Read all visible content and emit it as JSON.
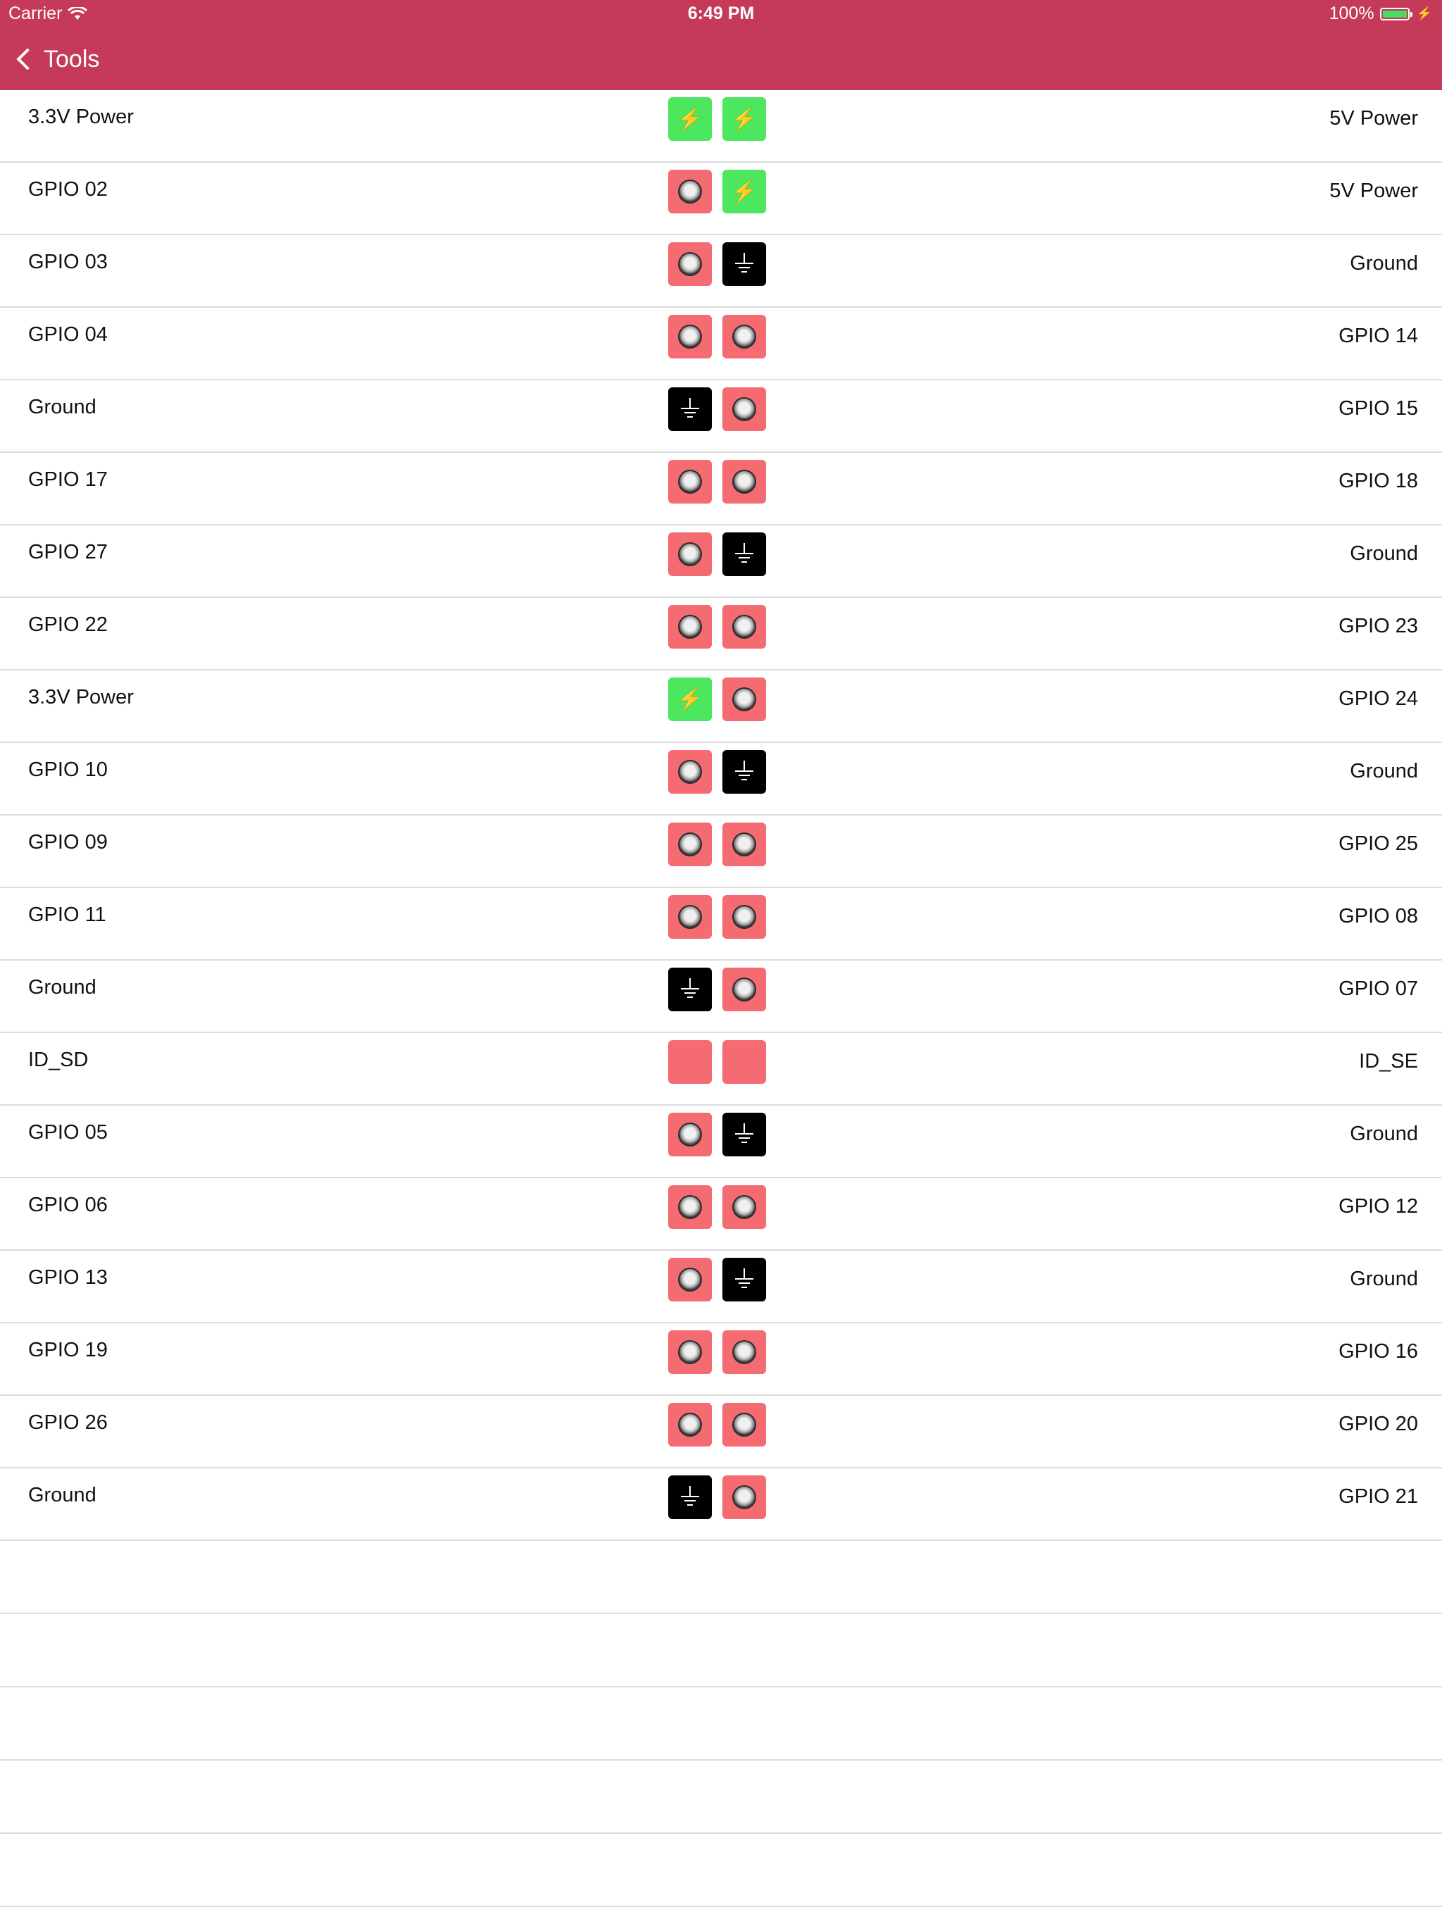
{
  "status_bar": {
    "carrier": "Carrier",
    "time": "6:49 PM",
    "battery": "100%"
  },
  "nav": {
    "back_label": "Tools"
  },
  "colors": {
    "brand": "#c53a59",
    "power": "#4ce65f",
    "gpio": "#f46b72",
    "ground": "#000000"
  },
  "pins": [
    {
      "left_label": "3.3V Power",
      "left_type": "power",
      "right_type": "power",
      "right_label": "5V Power"
    },
    {
      "left_label": "GPIO 02",
      "left_type": "gpio",
      "right_type": "power",
      "right_label": "5V Power"
    },
    {
      "left_label": "GPIO 03",
      "left_type": "gpio",
      "right_type": "ground",
      "right_label": "Ground"
    },
    {
      "left_label": "GPIO 04",
      "left_type": "gpio",
      "right_type": "gpio",
      "right_label": "GPIO 14"
    },
    {
      "left_label": "Ground",
      "left_type": "ground",
      "right_type": "gpio",
      "right_label": "GPIO 15"
    },
    {
      "left_label": "GPIO 17",
      "left_type": "gpio",
      "right_type": "gpio",
      "right_label": "GPIO 18"
    },
    {
      "left_label": "GPIO 27",
      "left_type": "gpio",
      "right_type": "ground",
      "right_label": "Ground"
    },
    {
      "left_label": "GPIO 22",
      "left_type": "gpio",
      "right_type": "gpio",
      "right_label": "GPIO 23"
    },
    {
      "left_label": "3.3V Power",
      "left_type": "power",
      "right_type": "gpio",
      "right_label": "GPIO 24"
    },
    {
      "left_label": "GPIO 10",
      "left_type": "gpio",
      "right_type": "ground",
      "right_label": "Ground"
    },
    {
      "left_label": "GPIO 09",
      "left_type": "gpio",
      "right_type": "gpio",
      "right_label": "GPIO 25"
    },
    {
      "left_label": "GPIO 11",
      "left_type": "gpio",
      "right_type": "gpio",
      "right_label": "GPIO 08"
    },
    {
      "left_label": "Ground",
      "left_type": "ground",
      "right_type": "gpio",
      "right_label": "GPIO 07"
    },
    {
      "left_label": "ID_SD",
      "left_type": "blank",
      "right_type": "blank",
      "right_label": "ID_SE"
    },
    {
      "left_label": "GPIO 05",
      "left_type": "gpio",
      "right_type": "ground",
      "right_label": "Ground"
    },
    {
      "left_label": "GPIO 06",
      "left_type": "gpio",
      "right_type": "gpio",
      "right_label": "GPIO 12"
    },
    {
      "left_label": "GPIO 13",
      "left_type": "gpio",
      "right_type": "ground",
      "right_label": "Ground"
    },
    {
      "left_label": "GPIO 19",
      "left_type": "gpio",
      "right_type": "gpio",
      "right_label": "GPIO 16"
    },
    {
      "left_label": "GPIO 26",
      "left_type": "gpio",
      "right_type": "gpio",
      "right_label": "GPIO 20"
    },
    {
      "left_label": "Ground",
      "left_type": "ground",
      "right_type": "gpio",
      "right_label": "GPIO 21"
    }
  ],
  "icons": {
    "power": "lightning-bolt-icon",
    "gpio": "pin-hole-icon",
    "ground": "ground-symbol-icon"
  }
}
